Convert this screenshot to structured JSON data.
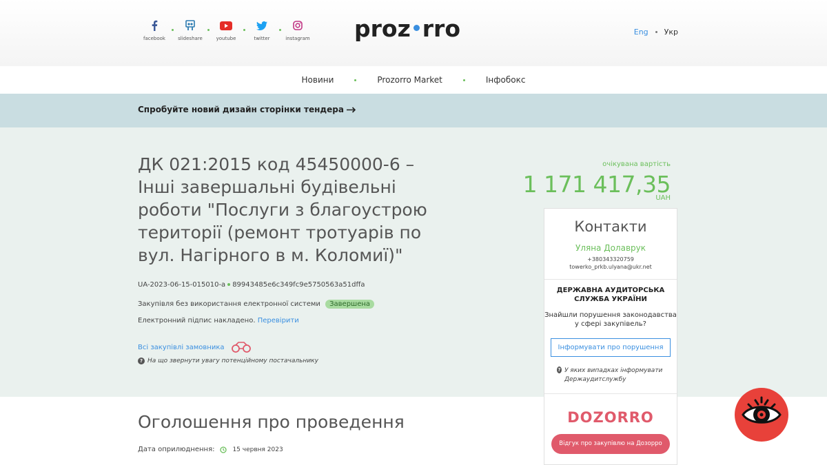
{
  "social": [
    {
      "icon": "facebook-icon",
      "label": "facebook",
      "color": "#3b5998"
    },
    {
      "icon": "slideshare-icon",
      "label": "slideshare",
      "color": "#2a7ab0"
    },
    {
      "icon": "youtube-icon",
      "label": "youtube",
      "color": "#e52d27"
    },
    {
      "icon": "twitter-icon",
      "label": "twitter",
      "color": "#1da1f2"
    },
    {
      "icon": "instagram-icon",
      "label": "instagram",
      "color": "#c13584"
    }
  ],
  "logo": {
    "left": "proz",
    "right": "rro"
  },
  "lang": {
    "eng": "Eng",
    "ukr": "Укр"
  },
  "nav": {
    "news": "Новини",
    "market": "Prozorro Market",
    "infobox": "Інфобокс"
  },
  "banner": {
    "text": "Спробуйте новий дизайн сторінки тендера"
  },
  "tender": {
    "title": "ДК 021:2015 код 45450000-6 – Інші завершальні будівельні роботи \"Послуги з благоустрою території (ремонт тротуарів по вул. Нагірного в м. Коломиї)\"",
    "id": "UA-2023-06-15-015010-a",
    "hash": "89943485e6c349fc9e5750563a51dffa",
    "procedure": "Закупівля без використання електронної системи",
    "status": "Завершена",
    "signature": "Електронний підпис накладено.",
    "verify": "Перевірити",
    "all_purchases": "Всі закупівлі замовника",
    "attention": "На що звернути увагу потенційному постачальнику"
  },
  "expected": {
    "label": "очікувана вартість",
    "value": "1 171 417,35",
    "currency": "UAH"
  },
  "contacts": {
    "title": "Контакти",
    "name": "Уляна Долаврук",
    "phone": "+380343320759",
    "email": "towerko_prkb.ulyana@ukr.net"
  },
  "das": {
    "title": "ДЕРЖАВНА АУДИТОРСЬКА СЛУЖБА УКРАЇНИ",
    "question": "Знайшли порушення законодавства у сфері закупівель?",
    "button": "Інформувати про порушення",
    "note": "У яких випадках інформувати Держаудитслужбу"
  },
  "dozorro": {
    "logo": "DOZORRO",
    "button": "Відгук про закупівлю на Дозорро"
  },
  "announcement": {
    "title": "Оголошення про проведення",
    "date_label": "Дата оприлюднення:",
    "date": "15 червня 2023"
  },
  "colors": {
    "green": "#6bbf5b",
    "blue": "#3a8fe0",
    "pink": "#e05a6b",
    "banner": "#c9dde1",
    "main_bg": "#eaf1ee"
  }
}
